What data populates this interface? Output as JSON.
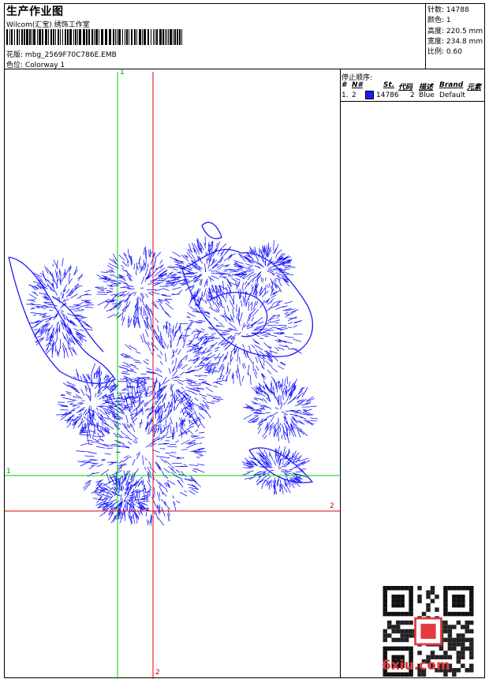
{
  "header": {
    "title": "生产作业图",
    "company": "Wilcom(汇宝) 绣饰工作室",
    "design_label": "花版:",
    "design_value": "mbg_2569F70C786E.EMB",
    "colorway_label": "色位:",
    "colorway_value": "Colorway 1"
  },
  "specs": [
    {
      "label": "针数:",
      "value": "14788"
    },
    {
      "label": "颜色:",
      "value": "1"
    },
    {
      "label": "高度:",
      "value": "220.5 mm"
    },
    {
      "label": "宽度:",
      "value": "234.8 mm"
    },
    {
      "label": "比例:",
      "value": "0.60"
    }
  ],
  "stop_sequence": {
    "title": "停止顺序:",
    "columns": [
      "#",
      "N#",
      "St.",
      "代码",
      "描述",
      "Brand",
      "元素"
    ],
    "rows": [
      {
        "index": "1.",
        "needle": "2",
        "stitches": "14786",
        "code": "2",
        "description": "Blue",
        "brand": "Default"
      }
    ]
  },
  "axes": {
    "green_label_top": "1",
    "green_label_left": "1",
    "red_label_bottom": "2",
    "red_label_right": "2"
  },
  "watermark": {
    "text": "6xiu.com"
  },
  "colors": {
    "thread": "#1a1aff",
    "green_axis": "#00cc00",
    "red_axis": "#dd0000",
    "watermark": "#e23b40"
  }
}
